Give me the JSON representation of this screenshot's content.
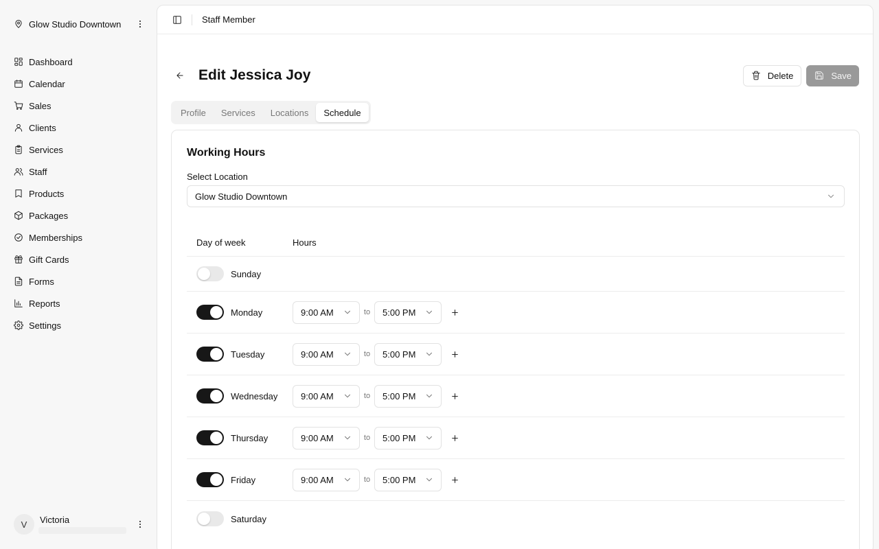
{
  "sidebar": {
    "location_name": "Glow Studio Downtown",
    "items": [
      {
        "label": "Dashboard",
        "icon": "dashboard-icon"
      },
      {
        "label": "Calendar",
        "icon": "calendar-icon"
      },
      {
        "label": "Sales",
        "icon": "cart-icon"
      },
      {
        "label": "Clients",
        "icon": "user-icon"
      },
      {
        "label": "Services",
        "icon": "clipboard-icon"
      },
      {
        "label": "Staff",
        "icon": "users-icon"
      },
      {
        "label": "Products",
        "icon": "tag-icon"
      },
      {
        "label": "Packages",
        "icon": "package-icon"
      },
      {
        "label": "Memberships",
        "icon": "badge-check-icon"
      },
      {
        "label": "Gift Cards",
        "icon": "gift-icon"
      },
      {
        "label": "Forms",
        "icon": "file-text-icon"
      },
      {
        "label": "Reports",
        "icon": "bar-chart-icon"
      },
      {
        "label": "Settings",
        "icon": "gear-icon"
      }
    ],
    "user": {
      "initial": "V",
      "name": "Victoria"
    }
  },
  "topbar": {
    "breadcrumb": "Staff Member"
  },
  "page": {
    "title": "Edit Jessica Joy",
    "delete_label": "Delete",
    "save_label": "Save",
    "tabs": [
      {
        "label": "Profile",
        "active": false
      },
      {
        "label": "Services",
        "active": false
      },
      {
        "label": "Locations",
        "active": false
      },
      {
        "label": "Schedule",
        "active": true
      }
    ]
  },
  "schedule": {
    "title": "Working Hours",
    "location_label": "Select Location",
    "location_value": "Glow Studio Downtown",
    "columns": {
      "day": "Day of week",
      "hours": "Hours"
    },
    "to_label": "to",
    "days": [
      {
        "name": "Sunday",
        "enabled": false
      },
      {
        "name": "Monday",
        "enabled": true,
        "start": "9:00 AM",
        "end": "5:00 PM"
      },
      {
        "name": "Tuesday",
        "enabled": true,
        "start": "9:00 AM",
        "end": "5:00 PM"
      },
      {
        "name": "Wednesday",
        "enabled": true,
        "start": "9:00 AM",
        "end": "5:00 PM"
      },
      {
        "name": "Thursday",
        "enabled": true,
        "start": "9:00 AM",
        "end": "5:00 PM"
      },
      {
        "name": "Friday",
        "enabled": true,
        "start": "9:00 AM",
        "end": "5:00 PM"
      },
      {
        "name": "Saturday",
        "enabled": false
      }
    ]
  },
  "colors": {
    "toggle_on": "#171717",
    "toggle_off": "#e9e9e9",
    "save_disabled": "#999999"
  }
}
